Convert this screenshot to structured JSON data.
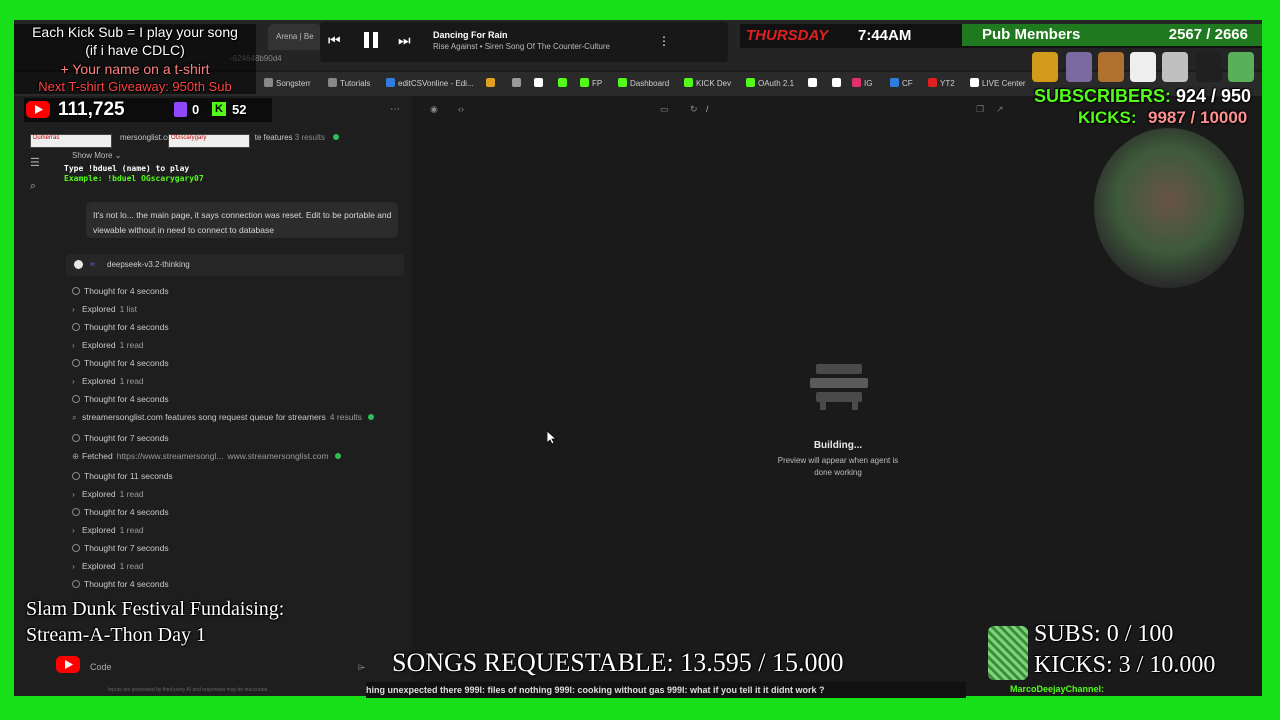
{
  "browser": {
    "tab_label": "Arena | Be",
    "address_fragment": "-624648b90d4",
    "bookmarks": [
      {
        "label": "Songsterr",
        "color": "#888888"
      },
      {
        "label": "Tutorials",
        "color": "#888888"
      },
      {
        "label": "editCSVonline - Edi...",
        "color": "#2f7de1"
      },
      {
        "label": "",
        "color": "#e0a020"
      },
      {
        "label": "",
        "color": "#9a9a9a"
      },
      {
        "label": "",
        "color": "#ffffff"
      },
      {
        "label": "",
        "color": "#53fc18"
      },
      {
        "label": "FP",
        "color": "#53fc18"
      },
      {
        "label": "Dashboard",
        "color": "#53fc18"
      },
      {
        "label": "KICK Dev",
        "color": "#53fc18"
      },
      {
        "label": "OAuth 2.1",
        "color": "#53fc18"
      },
      {
        "label": "",
        "color": "#ffffff"
      },
      {
        "label": "",
        "color": "#ffffff"
      },
      {
        "label": "IG",
        "color": "#e1306c"
      },
      {
        "label": "CF",
        "color": "#2f7de1"
      },
      {
        "label": "YT2",
        "color": "#e02020"
      },
      {
        "label": "LIVE Center",
        "color": "#ffffff"
      }
    ]
  },
  "chat": {
    "search_header": "mersonglist.com",
    "search_header_suffix": "te features",
    "search_header_count": "3 results",
    "show_more": "Show More",
    "duel_line1": "Type !bduel (name) to play",
    "duel_line2": "Example: !bduel OGscarygary07",
    "duel_user1": "Dumerras",
    "duel_user2": "OGscarygary",
    "user_message": "It's not lo... the main page, it says connection was reset. Edit to be portable and viewable without in need to connect to database",
    "model_name": "deepseek-v3.2-thinking",
    "steps": [
      {
        "kind": "thought",
        "text": "Thought for 4 seconds"
      },
      {
        "kind": "explored",
        "text": "Explored",
        "sub": "1 list"
      },
      {
        "kind": "thought",
        "text": "Thought for 4 seconds"
      },
      {
        "kind": "explored",
        "text": "Explored",
        "sub": "1 read"
      },
      {
        "kind": "thought",
        "text": "Thought for 4 seconds"
      },
      {
        "kind": "explored",
        "text": "Explored",
        "sub": "1 read"
      },
      {
        "kind": "thought",
        "text": "Thought for 4 seconds"
      },
      {
        "kind": "search",
        "text": "streamersonglist.com features song request queue for streamers",
        "sub": "4 results"
      },
      {
        "kind": "thought",
        "text": "Thought for 7 seconds"
      },
      {
        "kind": "fetched",
        "text": "Fetched",
        "sub": "https://www.streamersongl...",
        "sub2": "www.streamersonglist.com"
      },
      {
        "kind": "thought",
        "text": "Thought for 11 seconds"
      },
      {
        "kind": "explored",
        "text": "Explored",
        "sub": "1 read"
      },
      {
        "kind": "thought",
        "text": "Thought for 4 seconds"
      },
      {
        "kind": "explored",
        "text": "Explored",
        "sub": "1 read"
      },
      {
        "kind": "thought",
        "text": "Thought for 7 seconds"
      },
      {
        "kind": "explored",
        "text": "Explored",
        "sub": "1 read"
      },
      {
        "kind": "thought",
        "text": "Thought for 4 seconds"
      }
    ],
    "bottom_label": "Code",
    "disclaimer": "Inputs are processed by third-party AI and responses may be inaccurate."
  },
  "preview": {
    "path": "/",
    "building_title": "Building...",
    "building_sub": "Preview will appear when agent is done working"
  },
  "overlay": {
    "kick_sub_line1": "Each Kick Sub = I play your song",
    "kick_sub_line2": "(if i have CDLC)",
    "tshirt_line": "+ Your name on a t-shirt",
    "giveaway_line": "Next T-shirt Giveaway: 950th Sub",
    "yt_count": "111,725",
    "twitch_count": "0",
    "kick_count": "52",
    "now_playing_title": "Dancing For Rain",
    "now_playing_artist": "Rise Against • Siren Song Of The Counter-Culture",
    "day_time": "THURSDAY",
    "clock": "7:44AM",
    "pub_label": "Pub Members",
    "pub_count": "2567 / 2666",
    "subscribers_label": "SUBSCRIBERS:",
    "subscribers_value": "924 / 950",
    "kicks_label": "KICKS:",
    "kicks_value": "9987 / 10000",
    "festival_line1": "Slam Dunk Festival Fundaising:",
    "festival_line2": "Stream-A-Thon Day 1",
    "songs_requestable": "SONGS REQUESTABLE: 13.595 / 15.000",
    "goal_subs": "SUBS:  0 / 100",
    "goal_kicks": "KICKS: 3 / 10.000",
    "ticker": "hing unexpected there  999l: files of nothing  999l: cooking without gas  999l: what if you tell it it didnt work ?",
    "ticker_channel": "MarcoDeejayChannel:"
  },
  "colors": {
    "green_screen": "#18e018",
    "kick_green": "#53fc18",
    "youtube_red": "#ff0000",
    "twitch_purple": "#9146ff",
    "status_green": "#2ebd59"
  }
}
